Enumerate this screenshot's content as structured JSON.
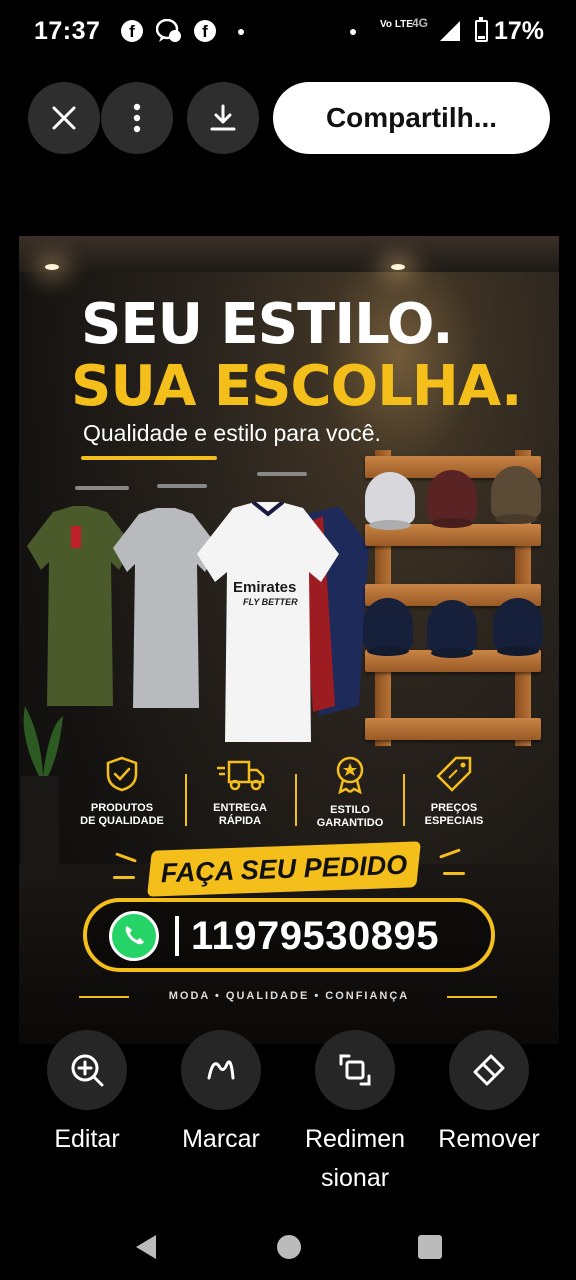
{
  "status_bar": {
    "time": "17:37",
    "notification_icons": [
      "facebook-icon",
      "messenger-icon",
      "facebook-icon",
      "dot-icon"
    ],
    "network_volte": "Vo LTE",
    "network_type": "4G",
    "battery_percent": "17%"
  },
  "toolbar": {
    "close_icon": "close-icon",
    "more_icon": "more-vert-icon",
    "download_icon": "download-icon",
    "share_label": "Compartilh..."
  },
  "poster": {
    "headline_line1": "SEU ESTILO.",
    "headline_line2": "SUA ESCOLHA.",
    "subtitle": "Qualidade e estilo para você.",
    "jersey_sponsor": "Emirates",
    "jersey_tagline": "FLY BETTER",
    "features": [
      {
        "icon": "shield-check-icon",
        "line1": "PRODUTOS",
        "line2": "DE QUALIDADE"
      },
      {
        "icon": "delivery-truck-icon",
        "line1": "ENTREGA",
        "line2": "RÁPIDA"
      },
      {
        "icon": "award-badge-icon",
        "line1": "ESTILO",
        "line2": "GARANTIDO"
      },
      {
        "icon": "price-tag-icon",
        "line1": "PREÇOS",
        "line2": "ESPECIAIS"
      }
    ],
    "cta": "FAÇA SEU PEDIDO",
    "phone": "11979530895",
    "footer": "MODA • QUALIDADE • CONFIANÇA",
    "accent_color": "#f5bf1b",
    "whatsapp_color": "#25d366"
  },
  "actions": [
    {
      "icon": "edit-search-icon",
      "label": "Editar"
    },
    {
      "icon": "markup-pen-icon",
      "label": "Marcar"
    },
    {
      "icon": "resize-icon",
      "label": "Redimen sionar"
    },
    {
      "icon": "eraser-icon",
      "label": "Remover"
    }
  ],
  "navigation": {
    "back": "back-icon",
    "home": "home-icon",
    "recents": "recents-icon"
  }
}
